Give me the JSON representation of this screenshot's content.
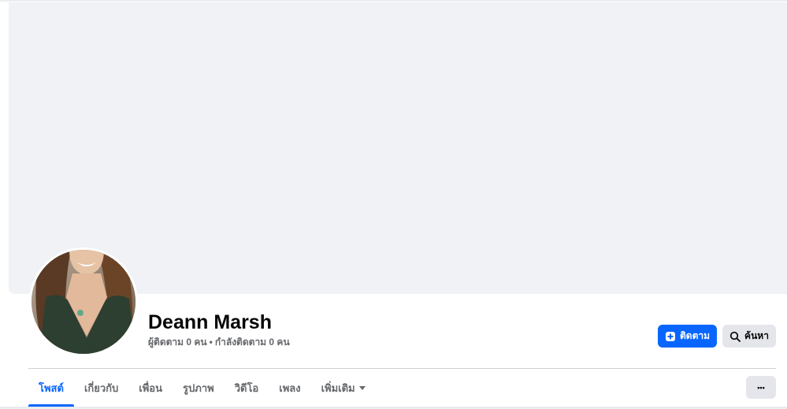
{
  "profile": {
    "name": "Deann Marsh",
    "followers": "ผู้ติดตาม 0 คน",
    "separator": "•",
    "following": "กำลังติดตาม 0 คน"
  },
  "actions": {
    "follow_label": "ติดตาม",
    "follow_icon": "follow-icon",
    "search_label": "ค้นหา",
    "search_icon": "search-icon",
    "more_label": "•••"
  },
  "tabs": [
    {
      "label": "โพสต์",
      "active": true
    },
    {
      "label": "เกี่ยวกับ",
      "active": false
    },
    {
      "label": "เพื่อน",
      "active": false
    },
    {
      "label": "รูปภาพ",
      "active": false
    },
    {
      "label": "วิดีโอ",
      "active": false
    },
    {
      "label": "เพลง",
      "active": false
    },
    {
      "label": "เพิ่มเติม",
      "active": false,
      "dropdown": true
    }
  ],
  "colors": {
    "accent": "#0866ff",
    "cover": "#f0f2f5",
    "button_gray": "#e4e6eb",
    "secondary_text": "#65676b"
  }
}
